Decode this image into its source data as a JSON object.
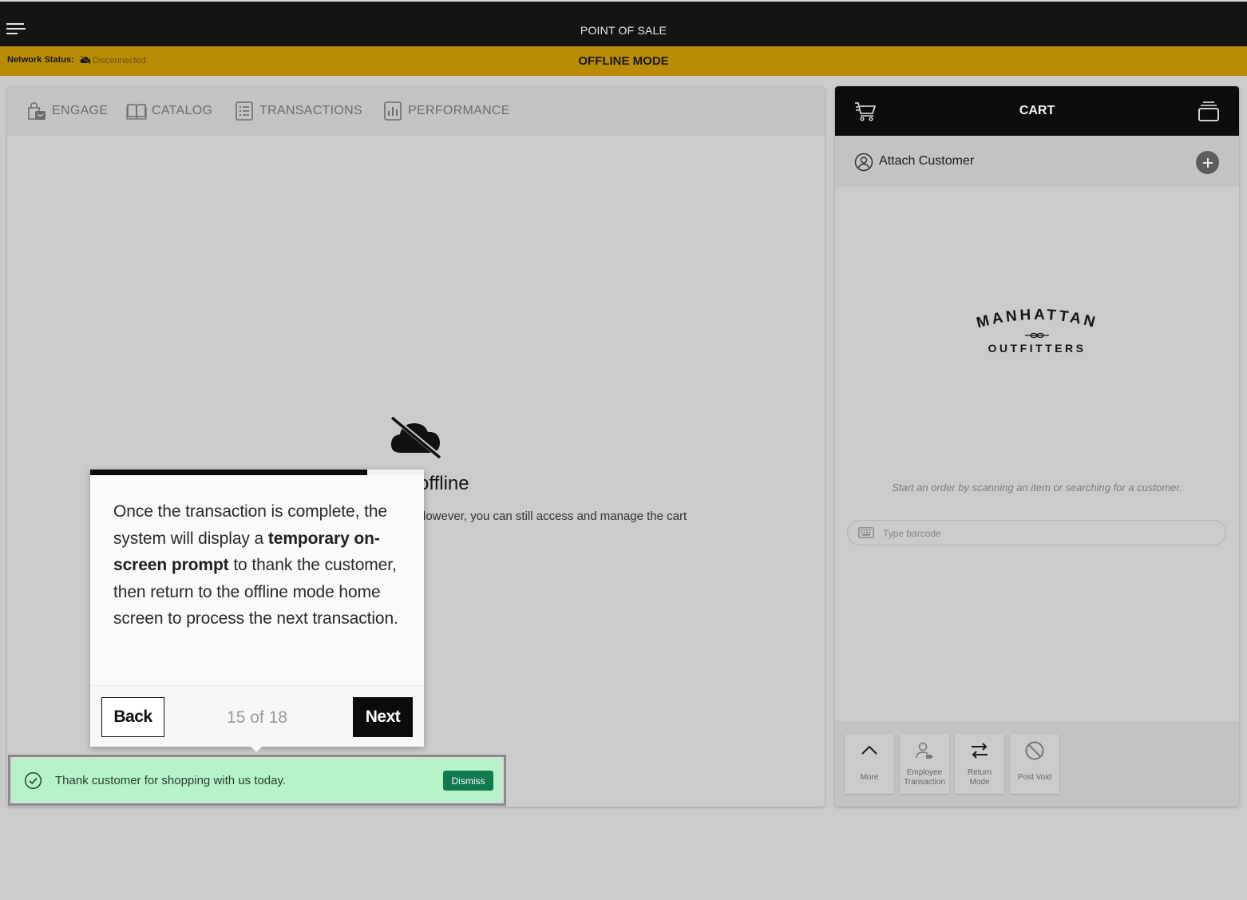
{
  "app": {
    "title": "POINT OF SALE"
  },
  "status_bar": {
    "network_label": "Network Status:",
    "network_value": "Disconnected",
    "mode": "OFFLINE MODE",
    "color": "#b98c08"
  },
  "tabs": [
    {
      "label": "ENGAGE",
      "icon": "engage-bag-icon"
    },
    {
      "label": "CATALOG",
      "icon": "catalog-book-icon"
    },
    {
      "label": "TRANSACTIONS",
      "icon": "transactions-list-icon"
    },
    {
      "label": "PERFORMANCE",
      "icon": "performance-chart-icon"
    }
  ],
  "offline": {
    "icon": "cloud-off-icon",
    "title": "offline",
    "description": "lowever, you can still access and manage the cart"
  },
  "cart": {
    "title": "CART",
    "attach_customer": "Attach Customer",
    "brand": {
      "line1": "MANHATTAN",
      "line2": "OUTFITTERS"
    },
    "hint": "Start an order by scanning an item or searching for a customer.",
    "barcode_placeholder": "Type barcode",
    "actions": [
      {
        "label_line1": "More",
        "label_line2": "",
        "icon": "chevron-up-icon"
      },
      {
        "label_line1": "Employee",
        "label_line2": "Transaction",
        "icon": "employee-transaction-icon"
      },
      {
        "label_line1": "Return",
        "label_line2": "Mode",
        "icon": "return-arrows-icon"
      },
      {
        "label_line1": "Post Void",
        "label_line2": "",
        "icon": "prohibited-icon"
      }
    ]
  },
  "tour": {
    "progress": 0.833,
    "text_before": "Once the transaction is complete, the system will display a ",
    "text_bold": "temporary on-screen prompt",
    "text_after": " to thank the customer, then return to the offline mode home screen to process the next transaction.",
    "back_label": "Back",
    "counter": "15 of 18",
    "next_label": "Next"
  },
  "toast": {
    "message": "Thank customer for shopping with us today.",
    "dismiss_label": "Dismiss",
    "icon": "check-circle-icon",
    "color": "#b7f3c9"
  }
}
